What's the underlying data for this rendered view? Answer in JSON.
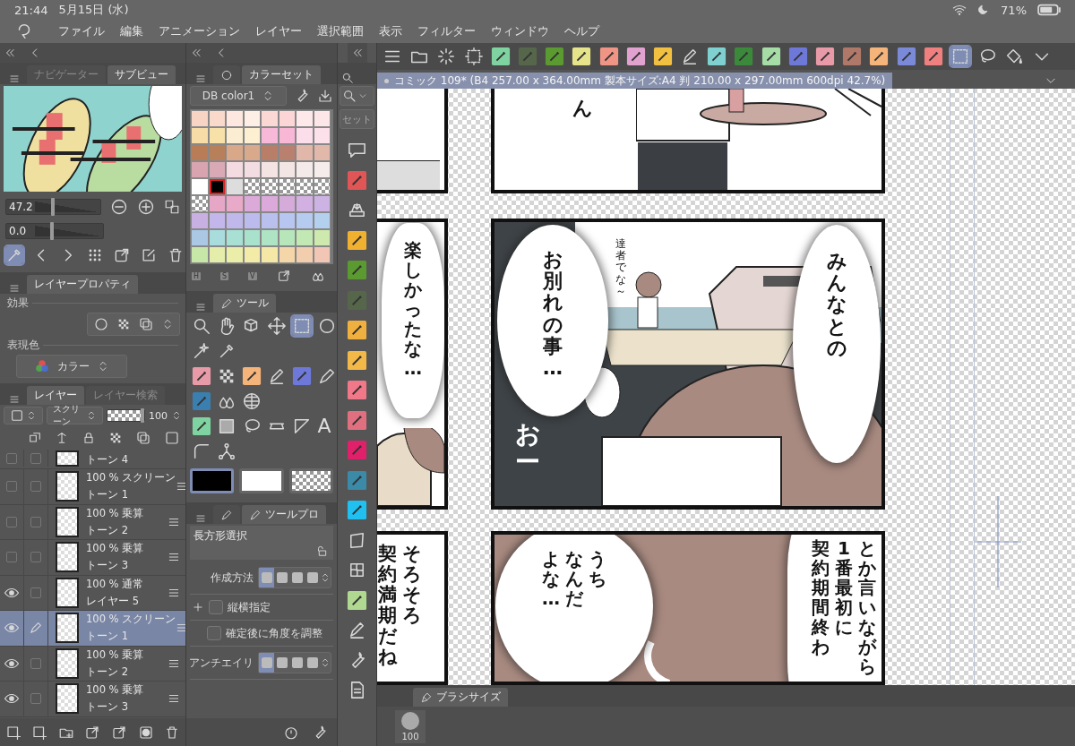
{
  "status_bar": {
    "time": "21:44",
    "date": "5月15日 (水)",
    "battery": "71%"
  },
  "menu": [
    "ファイル",
    "編集",
    "アニメーション",
    "レイヤー",
    "選択範囲",
    "表示",
    "フィルター",
    "ウィンドウ",
    "ヘルプ"
  ],
  "navigator": {
    "tabs": [
      {
        "label": "ナビゲーター",
        "selected": false
      },
      {
        "label": "サブビュー",
        "selected": true
      }
    ],
    "zoom": {
      "value": "47.2",
      "level": 0.48
    },
    "rotate": {
      "value": "0.0",
      "level": 0.45
    }
  },
  "layer_property": {
    "tab": "レイヤープロパティ",
    "effect_label": "効果",
    "color_label": "表現色",
    "color_mode": "カラー"
  },
  "layers": {
    "tabs": [
      {
        "label": "レイヤー",
        "selected": true
      },
      {
        "label": "レイヤー検索",
        "selected": false
      }
    ],
    "blend_mode": "スクリーン",
    "opacity": "100",
    "opacity_slider": {
      "level": 1
    },
    "rows": [
      {
        "name": "トーン 4",
        "visible": false,
        "editing": false,
        "selected": false
      },
      {
        "opacity": "100 %",
        "blend": "スクリーン",
        "name": "トーン 1",
        "visible": false,
        "editing": false,
        "selected": false
      },
      {
        "opacity": "100 %",
        "blend": "乗算",
        "name": "トーン 2",
        "visible": false,
        "editing": false,
        "selected": false
      },
      {
        "opacity": "100 %",
        "blend": "乗算",
        "name": "トーン 3",
        "visible": false,
        "editing": false,
        "selected": false
      },
      {
        "opacity": "100 %",
        "blend": "通常",
        "name": "レイヤー 5",
        "visible": true,
        "editing": false,
        "selected": false
      },
      {
        "opacity": "100 %",
        "blend": "スクリーン",
        "name": "トーン 1",
        "visible": true,
        "editing": true,
        "selected": true
      },
      {
        "opacity": "100 %",
        "blend": "乗算",
        "name": "トーン 2",
        "visible": true,
        "editing": false,
        "selected": false
      },
      {
        "opacity": "100 %",
        "blend": "乗算",
        "name": "トーン 3",
        "visible": true,
        "editing": false,
        "selected": false
      }
    ]
  },
  "color_set": {
    "tab": "カラーセット",
    "palette": "DB color1",
    "rows": [
      [
        {
          "color": "#f7d4c4",
          "selected": false
        },
        {
          "color": "#f9d9c9",
          "selected": false
        },
        {
          "color": "#fde8e0",
          "selected": false
        },
        {
          "color": "#fdeee6",
          "selected": false
        },
        {
          "color": "#fbd8d4",
          "selected": false
        },
        {
          "color": "#fcd6d6",
          "selected": false
        },
        {
          "color": "#fde9ea",
          "selected": false
        },
        {
          "color": "#fde6e8",
          "selected": false
        }
      ],
      [
        {
          "color": "#f7dca8",
          "selected": false
        },
        {
          "color": "#f7e1a9",
          "selected": false
        },
        {
          "color": "#fbedd1",
          "selected": false
        },
        {
          "color": "#fcefd2",
          "selected": false
        },
        {
          "color": "#f8b8d8",
          "selected": false
        },
        {
          "color": "#f9b7d6",
          "selected": false
        },
        {
          "color": "#fbdeea",
          "selected": false
        },
        {
          "color": "#fce0ea",
          "selected": false
        }
      ],
      [
        {
          "color": "#b87c57",
          "selected": false
        },
        {
          "color": "#b8805a",
          "selected": false
        },
        {
          "color": "#d9a888",
          "selected": false
        },
        {
          "color": "#d8a98a",
          "selected": false
        },
        {
          "color": "#b87e68",
          "selected": false
        },
        {
          "color": "#b98070",
          "selected": false
        },
        {
          "color": "#e0b7a8",
          "selected": false
        },
        {
          "color": "#e2b8aa",
          "selected": false
        }
      ],
      [
        {
          "color": "#d8a4b0",
          "selected": false
        },
        {
          "color": "#d9a9b5",
          "selected": false
        },
        {
          "color": "#f3dbe1",
          "selected": false
        },
        {
          "color": "#f3dde2",
          "selected": false
        },
        {
          "color": "#f3e3e3",
          "selected": false
        },
        {
          "color": "#f4e5e5",
          "selected": false
        },
        {
          "color": "#f5eaea",
          "selected": false
        },
        {
          "color": "#f6ecec",
          "selected": false
        }
      ],
      [
        {
          "color": "#ffffff",
          "selected": false
        },
        {
          "color": "#000000",
          "selected": true
        },
        {
          "color": "#dddddd",
          "selected": false
        },
        {
          "kind": "transparent",
          "selected": false
        },
        {
          "kind": "transparent",
          "selected": false
        },
        {
          "kind": "transparent",
          "selected": false
        },
        {
          "kind": "transparent",
          "selected": false
        },
        {
          "kind": "transparent",
          "selected": false
        }
      ],
      [
        {
          "kind": "transparent",
          "selected": false
        },
        {
          "color": "#e6a7c7",
          "selected": false
        },
        {
          "color": "#e9a9c8",
          "selected": false
        },
        {
          "color": "#dcaad9",
          "selected": false
        },
        {
          "color": "#dba9da",
          "selected": false
        },
        {
          "color": "#d5acd9",
          "selected": false
        },
        {
          "color": "#d2b0e2",
          "selected": false
        },
        {
          "color": "#cdb3e4",
          "selected": false
        }
      ],
      [
        {
          "color": "#c9b0e3",
          "selected": false
        },
        {
          "color": "#c2b6ea",
          "selected": false
        },
        {
          "color": "#c0b8eb",
          "selected": false
        },
        {
          "color": "#bcbbee",
          "selected": false
        },
        {
          "color": "#b9c0ee",
          "selected": false
        },
        {
          "color": "#b7c6f0",
          "selected": false
        },
        {
          "color": "#b5cbf0",
          "selected": false
        },
        {
          "color": "#b4d0ef",
          "selected": false
        }
      ],
      [
        {
          "color": "#aac8e4",
          "selected": false
        },
        {
          "color": "#a9dcdc",
          "selected": false
        },
        {
          "color": "#a8e0d4",
          "selected": false
        },
        {
          "color": "#a9e2cc",
          "selected": false
        },
        {
          "color": "#aee4c3",
          "selected": false
        },
        {
          "color": "#b8e6bb",
          "selected": false
        },
        {
          "color": "#c2e8b4",
          "selected": false
        },
        {
          "color": "#cde9ae",
          "selected": false
        }
      ],
      [
        {
          "color": "#c6e7a8",
          "selected": false
        },
        {
          "color": "#e4eeaa",
          "selected": false
        },
        {
          "color": "#eaeea8",
          "selected": false
        },
        {
          "color": "#f2eca8",
          "selected": false
        },
        {
          "color": "#f5e8a6",
          "selected": false
        },
        {
          "color": "#f5d6a8",
          "selected": false
        },
        {
          "color": "#f2cdae",
          "selected": false
        },
        {
          "color": "#f1c6b4",
          "selected": false
        }
      ]
    ],
    "channel_labels": [
      "H",
      "S",
      "V"
    ]
  },
  "tools": {
    "tab": "ツール",
    "rows": [
      [
        {
          "kind": "magnifier",
          "selected": false
        },
        {
          "kind": "hand",
          "selected": false
        },
        {
          "kind": "cube",
          "selected": false
        },
        {
          "kind": "move",
          "selected": false
        },
        {
          "kind": "rect-select",
          "selected": true
        },
        {
          "kind": "circle",
          "selected": false
        }
      ],
      [
        {
          "kind": "wand",
          "selected": false
        },
        {
          "kind": "eyedropper",
          "selected": false
        }
      ],
      [
        {
          "kind": "tile",
          "color": "#e89aa8",
          "selected": false
        },
        {
          "kind": "pattern",
          "selected": false
        },
        {
          "kind": "tile",
          "color": "#f4b47a",
          "selected": false
        },
        {
          "kind": "pencil",
          "selected": false
        },
        {
          "kind": "tile",
          "color": "#6d78d8",
          "selected": false
        },
        {
          "kind": "pen",
          "selected": false
        }
      ],
      [
        {
          "kind": "tile",
          "color": "#3b7fb0",
          "selected": false
        },
        {
          "kind": "drops",
          "selected": false
        },
        {
          "kind": "globe",
          "selected": false
        }
      ],
      [
        {
          "kind": "tile",
          "color": "#7fd3a0",
          "selected": false
        },
        {
          "kind": "gradient",
          "selected": false
        },
        {
          "kind": "lasso",
          "selected": false
        },
        {
          "kind": "ruler",
          "selected": false
        },
        {
          "kind": "triangle",
          "selected": false
        },
        {
          "kind": "text",
          "label": "A",
          "selected": false
        }
      ],
      [
        {
          "kind": "curve",
          "selected": false
        },
        {
          "kind": "vector",
          "selected": false
        }
      ]
    ],
    "colors": [
      {
        "kind": "main",
        "color": "#000000",
        "selected": true
      },
      {
        "kind": "sub",
        "color": "#ffffff",
        "selected": false
      },
      {
        "kind": "transparent",
        "selected": false
      }
    ]
  },
  "tool_property": {
    "tab": "ツールプロ",
    "title": "長方形選択",
    "rows": [
      {
        "kind": "segmented",
        "label": "作成方法",
        "options": [
          {
            "selected": true
          },
          {
            "selected": false
          },
          {
            "selected": false
          },
          {
            "selected": false
          }
        ]
      },
      {
        "kind": "checkbox",
        "label": "縦横指定",
        "checked": false,
        "expandable": true
      },
      {
        "kind": "checkbox",
        "label": "確定後に角度を調整",
        "checked": false,
        "expandable": false
      },
      {
        "kind": "segmented",
        "label": "アンチエイリ",
        "options": [
          {
            "selected": true
          },
          {
            "selected": false
          },
          {
            "selected": false
          },
          {
            "selected": false
          }
        ]
      }
    ]
  },
  "side_palette": {
    "set_label": "セット",
    "icons": [
      {
        "kind": "new"
      },
      {
        "kind": "tile",
        "color": "#e05555"
      },
      {
        "kind": "tray"
      },
      {
        "kind": "tile",
        "color": "#f0b030"
      },
      {
        "kind": "tile",
        "color": "#5a9a30"
      },
      {
        "kind": "tile",
        "color": "#56664a"
      },
      {
        "kind": "tile",
        "color": "#f0b040"
      },
      {
        "kind": "tile",
        "color": "#f2b848"
      },
      {
        "kind": "tile",
        "color": "#f07888"
      },
      {
        "kind": "tile",
        "color": "#e07080"
      },
      {
        "kind": "tile",
        "color": "#e0206a"
      },
      {
        "kind": "tile",
        "color": "#3a8aa8"
      },
      {
        "kind": "tile",
        "color": "#20c0f0"
      },
      {
        "kind": "quad"
      },
      {
        "kind": "mesh"
      },
      {
        "kind": "tile",
        "color": "#b0d890"
      },
      {
        "kind": "pencil"
      },
      {
        "kind": "wrench"
      },
      {
        "kind": "document"
      }
    ]
  },
  "toolbar": [
    {
      "kind": "menu",
      "selected": false
    },
    {
      "kind": "folder",
      "selected": false
    },
    {
      "kind": "spinner",
      "selected": false
    },
    {
      "kind": "transform",
      "selected": false
    },
    {
      "kind": "tile",
      "color": "#7fd3a0",
      "selected": false
    },
    {
      "kind": "tile",
      "color": "#56664a",
      "selected": false
    },
    {
      "kind": "tile",
      "color": "#5a9a30",
      "selected": false
    },
    {
      "kind": "tile",
      "color": "#e6e48a",
      "selected": false
    },
    {
      "kind": "tile",
      "color": "#f09486",
      "selected": false
    },
    {
      "kind": "tile",
      "color": "#e2a2d0",
      "selected": false
    },
    {
      "kind": "tile",
      "color": "#f2c040",
      "selected": false
    },
    {
      "kind": "pencil",
      "selected": false
    },
    {
      "kind": "tile",
      "color": "#7fd0d0",
      "selected": false
    },
    {
      "kind": "tile",
      "color": "#3b8a3b",
      "selected": false
    },
    {
      "kind": "tile",
      "color": "#a6dca6",
      "selected": false
    },
    {
      "kind": "tile",
      "color": "#6d78d8",
      "selected": false
    },
    {
      "kind": "tile",
      "color": "#e89aa8",
      "selected": false
    },
    {
      "kind": "tile",
      "color": "#b07868",
      "selected": false
    },
    {
      "kind": "tile",
      "color": "#f4b47a",
      "selected": false
    },
    {
      "kind": "tile",
      "color": "#7a8ad8",
      "selected": false
    },
    {
      "kind": "tile",
      "color": "#f08080",
      "selected": false
    },
    {
      "kind": "rect-select",
      "selected": true
    },
    {
      "kind": "lasso",
      "selected": false
    },
    {
      "kind": "fill",
      "selected": false
    },
    {
      "kind": "chevron-down",
      "selected": false
    }
  ],
  "document_tab": "コミック 109* (B4 257.00 x 364.00mm 製本サイズ:A4 判 210.00 x 297.00mm 600dpi 42.7%)",
  "manga": {
    "top_panel": {
      "sfx": "ん"
    },
    "middle_left": {
      "columns": [
        "楽しかったな…"
      ]
    },
    "middle_main": {
      "bubbles": [
        {
          "columns": [
            "お別れの事…"
          ]
        },
        {
          "columns": [
            "みんなとの"
          ]
        }
      ],
      "small_text": "達者でな～",
      "sfx": "おー"
    },
    "bottom_left": {
      "columns": [
        "契約満期だね",
        "そろそろ"
      ]
    },
    "bottom_main": {
      "bubbles": [
        {
          "columns": [
            "よな…",
            "なんだ",
            "うち"
          ]
        },
        {
          "columns": [
            "契約期間終わ",
            "1番最初に",
            "とか言いながら"
          ]
        }
      ]
    }
  },
  "brush_panel": {
    "tab": "ブラシサイズ",
    "size": "100"
  }
}
